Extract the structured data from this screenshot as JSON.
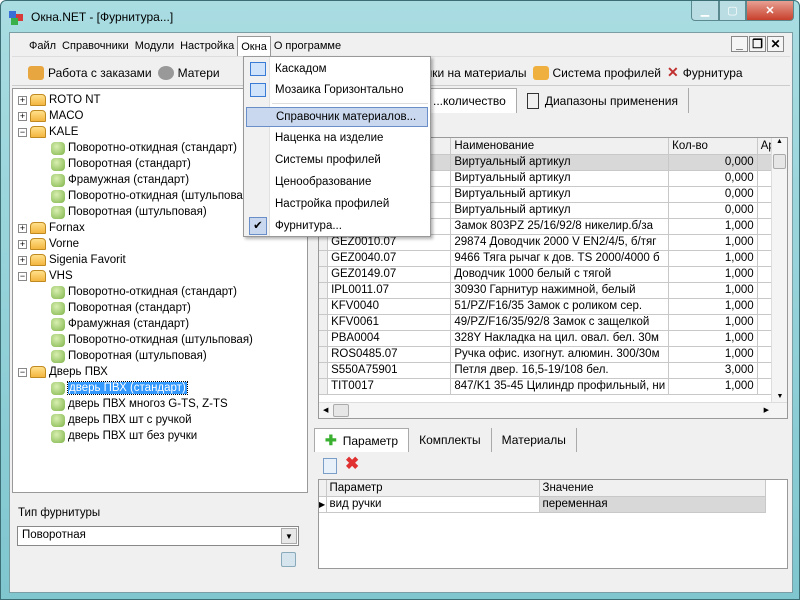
{
  "window": {
    "title": "Окна.NET - [Фурнитура...]"
  },
  "menubar": {
    "items": [
      "Файл",
      "Справочники",
      "Модули",
      "Настройка",
      "Окна",
      "О программе"
    ]
  },
  "toolbar": {
    "items": [
      {
        "label": "Работа с заказами",
        "icon": "user-icon"
      },
      {
        "label": "Матери",
        "icon": "gear-icon"
      },
      {
        "label": "...ки/наценки на материалы",
        "icon": "tag-icon"
      },
      {
        "label": "Система профилей",
        "icon": "cubes-icon"
      },
      {
        "label": "Фурнитура",
        "icon": "tools-icon"
      }
    ]
  },
  "windows_menu": {
    "items": [
      {
        "label": "Каскадом",
        "icon": "cascade-icon"
      },
      {
        "label": "Мозаика Горизонтально",
        "icon": "tile-horizontal-icon"
      },
      {
        "label": "Справочник материалов...",
        "highlighted": true
      },
      {
        "label": "Наценка на изделие"
      },
      {
        "label": "Системы профилей"
      },
      {
        "label": "Ценообразование"
      },
      {
        "label": "Настройка профилей"
      },
      {
        "label": "Фурнитура...",
        "checked": true
      }
    ]
  },
  "tree": [
    {
      "label": "ROTO NT",
      "level": 0,
      "type": "folder",
      "expander": "+"
    },
    {
      "label": "MACO",
      "level": 0,
      "type": "folder",
      "expander": "+"
    },
    {
      "label": "KALE",
      "level": 0,
      "type": "folder",
      "expander": "-"
    },
    {
      "label": "Поворотно-откидная (стандарт)",
      "level": 1
    },
    {
      "label": "Поворотная (стандарт)",
      "level": 1
    },
    {
      "label": "Фрамужная (стандарт)",
      "level": 1
    },
    {
      "label": "Поворотно-откидная (штульповая)",
      "level": 1
    },
    {
      "label": "Поворотная (штульповая)",
      "level": 1
    },
    {
      "label": "Fornax",
      "level": 0,
      "type": "folder",
      "expander": "+"
    },
    {
      "label": "Vorne",
      "level": 0,
      "type": "folder",
      "expander": "+"
    },
    {
      "label": "Sigenia Favorit",
      "level": 0,
      "type": "folder",
      "expander": "+"
    },
    {
      "label": "VHS",
      "level": 0,
      "type": "folder",
      "expander": "-"
    },
    {
      "label": "Поворотно-откидная (стандарт)",
      "level": 1
    },
    {
      "label": "Поворотная (стандарт)",
      "level": 1
    },
    {
      "label": "Фрамужная (стандарт)",
      "level": 1
    },
    {
      "label": "Поворотно-откидная (штульповая)",
      "level": 1
    },
    {
      "label": "Поворотная (штульповая)",
      "level": 1
    },
    {
      "label": "Дверь ПВХ",
      "level": 0,
      "type": "folder",
      "expander": "-"
    },
    {
      "label": "дверь ПВХ (стандарт)",
      "level": 1,
      "selected": true
    },
    {
      "label": "дверь ПВХ многоз G-TS, Z-TS",
      "level": 1
    },
    {
      "label": "дверь ПВХ шт с ручкой",
      "level": 1
    },
    {
      "label": "дверь ПВХ шт без ручки",
      "level": 1
    }
  ],
  "fittings_type": {
    "label": "Тип фурнитуры",
    "value": "Поворотная"
  },
  "top_tabs": [
    {
      "label": "...количество"
    },
    {
      "label": "Диапазоны применения"
    }
  ],
  "materials_grid": {
    "columns": [
      "",
      "Наименование",
      "Кол-во",
      "Артı"
    ],
    "rows": [
      [
        "",
        "Виртуальный артикул",
        "0,000"
      ],
      [
        "",
        "Виртуальный артикул",
        "0,000"
      ],
      [
        "",
        "Виртуальный артикул",
        "0,000"
      ],
      [
        "",
        "Виртуальный артикул",
        "0,000"
      ],
      [
        "",
        "Замок 803PZ 25/16/92/8 никелир.б/за",
        "1,000"
      ],
      [
        "GEZ0010.07",
        "29874 Доводчик 2000 V EN2/4/5, б/тяг",
        "1,000"
      ],
      [
        "GEZ0040.07",
        "9466 Тяга рычаг к дов. TS 2000/4000 б",
        "1,000"
      ],
      [
        "GEZ0149.07",
        "Доводчик 1000 белый с тягой",
        "1,000"
      ],
      [
        "IPL0011.07",
        "30930 Гарнитур нажимной, белый",
        "1,000"
      ],
      [
        "KFV0040",
        "51/PZ/F16/35 Замок с роликом сер.",
        "1,000"
      ],
      [
        "KFV0061",
        "49/PZ/F16/35/92/8 Замок с защелкой",
        "1,000"
      ],
      [
        "PBA0004",
        "328Y Накладка  на цил. овал. бел. 30м",
        "1,000"
      ],
      [
        "ROS0485.07",
        "Ручка офис. изогнут. алюмин. 300/30м",
        "1,000"
      ],
      [
        "S550A75901",
        "Петля двер. 16,5-19/108 бел.",
        "3,000"
      ],
      [
        "TIT0017",
        "847/K1 35-45 Цилиндр профильный, ни",
        "1,000"
      ]
    ]
  },
  "bottom_tabs": [
    {
      "label": "Параметр",
      "icon": "plus-icon"
    },
    {
      "label": "Комплекты"
    },
    {
      "label": "Материалы"
    }
  ],
  "param_grid": {
    "columns": [
      "Параметр",
      "Значение"
    ],
    "rows": [
      [
        "вид ручки",
        "переменная"
      ]
    ]
  }
}
